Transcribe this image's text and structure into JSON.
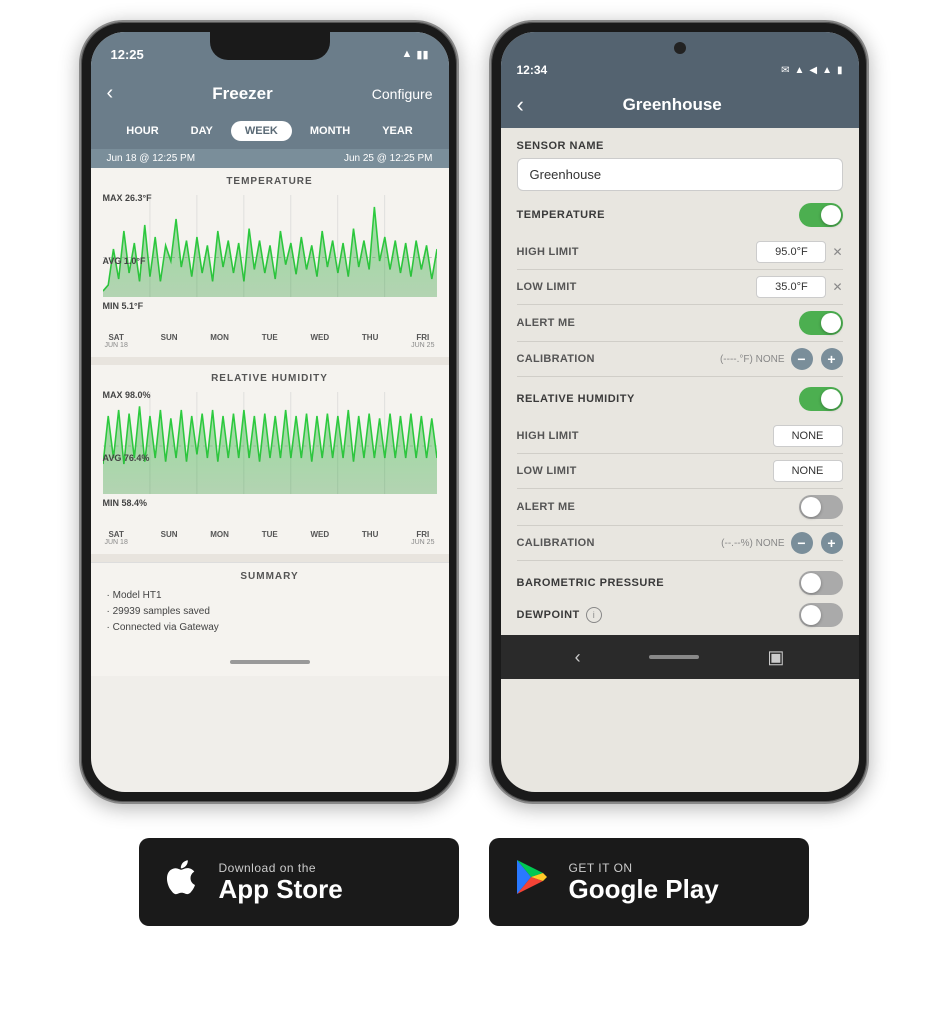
{
  "iphone": {
    "status_time": "12:25",
    "title": "Freezer",
    "configure": "Configure",
    "time_options": [
      "HOUR",
      "DAY",
      "WEEK",
      "MONTH",
      "YEAR"
    ],
    "active_time": "WEEK",
    "date_start": "Jun 18 @ 12:25 PM",
    "date_end": "Jun 25 @ 12:25 PM",
    "temp_label": "TEMPERATURE",
    "temp_max": "MAX 26.3°F",
    "temp_avg": "AVG 1.0°F",
    "temp_min": "MIN 5.1°F",
    "humidity_label": "RELATIVE HUMIDITY",
    "humidity_max": "MAX 98.0%",
    "humidity_avg": "AVG 76.4%",
    "humidity_min": "MIN 58.4%",
    "days": [
      {
        "weekday": "SAT",
        "date": "JUN 18"
      },
      {
        "weekday": "SUN",
        "date": ""
      },
      {
        "weekday": "MON",
        "date": ""
      },
      {
        "weekday": "TUE",
        "date": ""
      },
      {
        "weekday": "WED",
        "date": ""
      },
      {
        "weekday": "THU",
        "date": ""
      },
      {
        "weekday": "FRI",
        "date": "JUN 25"
      }
    ],
    "summary_label": "SUMMARY",
    "summary_items": [
      "· Model HT1",
      "· 29939 samples saved",
      "· Connected via Gateway"
    ]
  },
  "android": {
    "status_time": "12:34",
    "status_icons": "M ▲",
    "title": "Greenhouse",
    "sensor_name_label": "SENSOR NAME",
    "sensor_name_value": "Greenhouse",
    "sensor_name_placeholder": "Greenhouse",
    "temperature_label": "TEMPERATURE",
    "temperature_toggle": "on",
    "high_limit_label": "HIGH LIMIT",
    "high_limit_value": "95.0°F",
    "low_limit_label": "LOW LIMIT",
    "low_limit_value": "35.0°F",
    "alert_me_label": "ALERT ME",
    "alert_me_toggle": "on",
    "calibration_label": "CALIBRATION",
    "calibration_value": "(----.°F) NONE",
    "relative_humidity_label": "RELATIVE HUMIDITY",
    "relative_humidity_toggle": "on",
    "rh_high_label": "HIGH LIMIT",
    "rh_high_value": "NONE",
    "rh_low_label": "LOW LIMIT",
    "rh_low_value": "NONE",
    "rh_alert_label": "ALERT ME",
    "rh_alert_toggle": "off",
    "rh_calibration_label": "CALIBRATION",
    "rh_calibration_value": "(--.--%) NONE",
    "barometric_label": "BAROMETRIC PRESSURE",
    "barometric_toggle": "off",
    "dewpoint_label": "DEWPOINT",
    "dewpoint_toggle": "off"
  },
  "appstore": {
    "pre_label": "Download on the",
    "name": "App Store",
    "icon": "apple"
  },
  "googleplay": {
    "pre_label": "GET IT ON",
    "name": "Google Play",
    "icon": "play"
  }
}
